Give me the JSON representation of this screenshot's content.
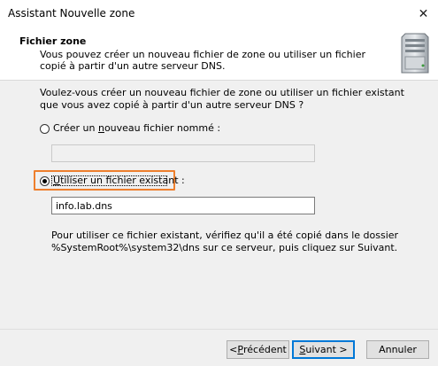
{
  "window": {
    "title": "Assistant Nouvelle zone",
    "close_glyph": "✕"
  },
  "header": {
    "title": "Fichier zone",
    "description": "Vous pouvez créer un nouveau fichier de zone ou utiliser un fichier copié à partir d'un autre serveur DNS.",
    "icon": "server-icon"
  },
  "body": {
    "question": "Voulez-vous créer un nouveau fichier de zone ou utiliser un fichier existant que vous avez copié à partir d'un autre serveur DNS ?",
    "option_new": {
      "label_pre": "Créer un ",
      "label_accel": "n",
      "label_post": "ouveau fichier nommé :",
      "selected": false
    },
    "new_file_value": "",
    "option_existing": {
      "label_pre": "",
      "label_accel": "U",
      "label_post": "tiliser un fichier existant :",
      "selected": true
    },
    "existing_file_value": "info.lab.dns",
    "info": "Pour utiliser ce fichier existant, vérifiez qu'il a été copié dans le dossier %SystemRoot%\\system32\\dns sur ce serveur, puis cliquez sur Suivant."
  },
  "footer": {
    "back": {
      "pre": "< ",
      "accel": "P",
      "post": "récédent"
    },
    "next": {
      "pre": "",
      "accel": "S",
      "post": "uivant >"
    },
    "cancel": "Annuler"
  },
  "colors": {
    "highlight": "#ee7f2d",
    "default_button_border": "#0078d7"
  }
}
